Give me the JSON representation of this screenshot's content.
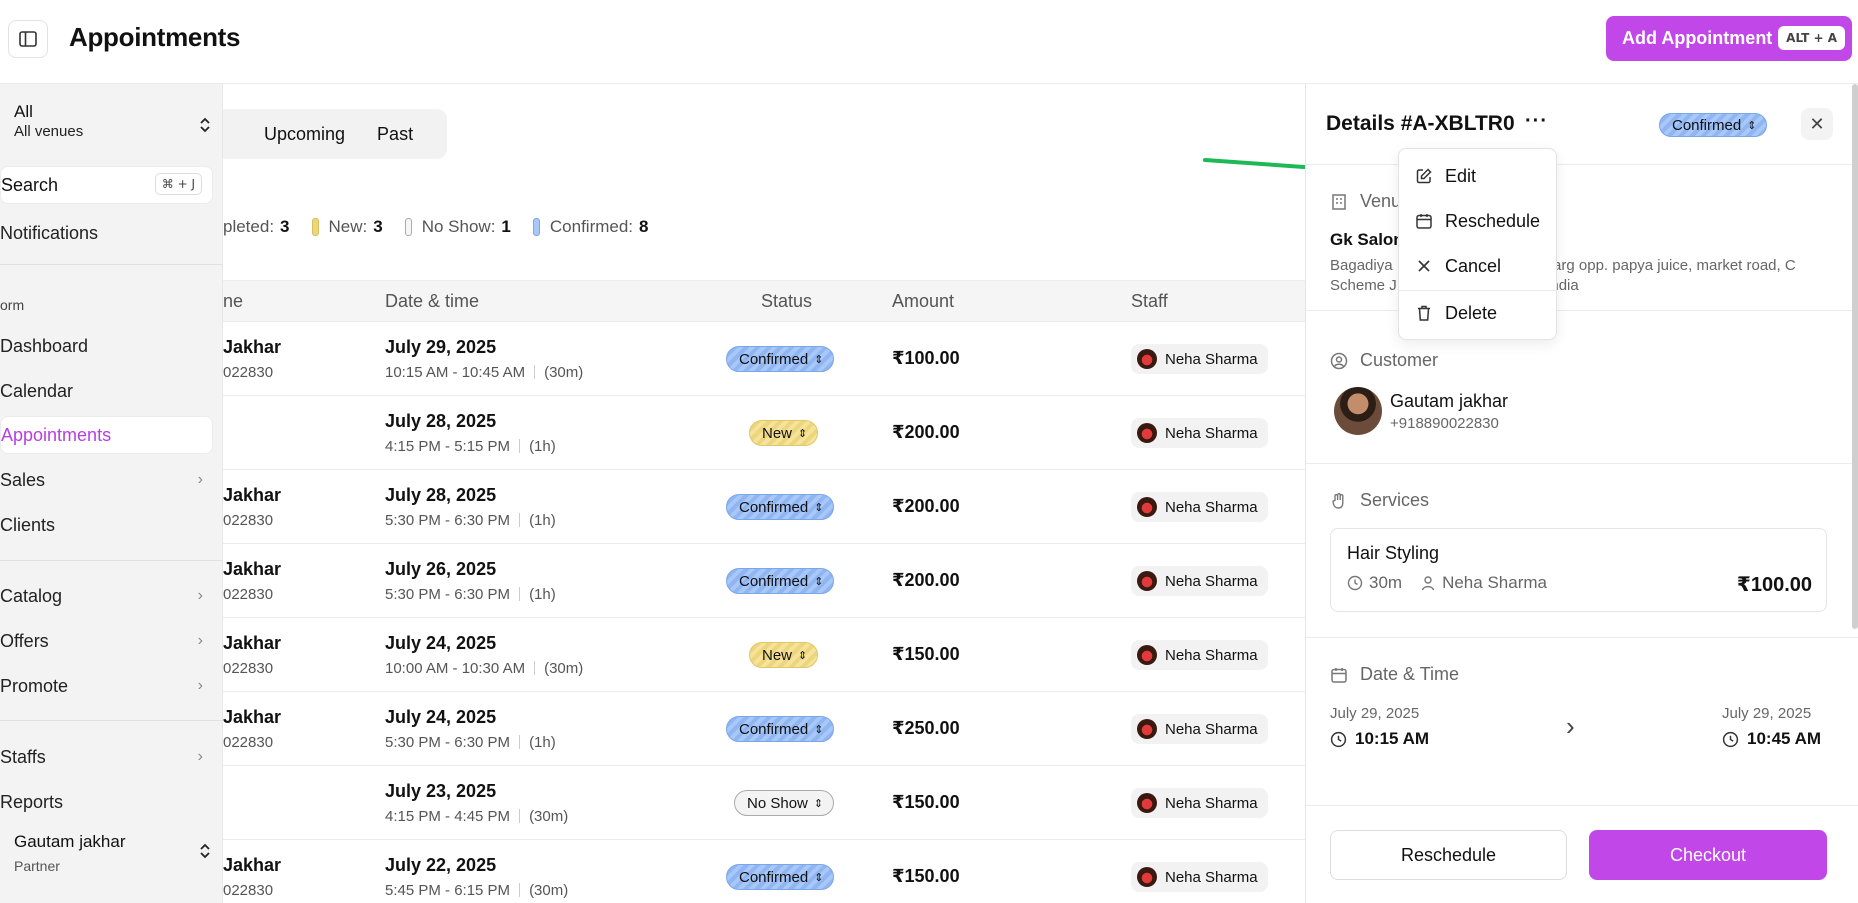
{
  "header": {
    "title": "Appointments",
    "add_button": "Add Appointment",
    "add_shortcut": "ALT + A"
  },
  "sidebar": {
    "venue_title": "All",
    "venue_subtitle": "All venues",
    "search_label": "Search",
    "search_shortcut": "⌘ + J",
    "notifications": "Notifications",
    "section_label": "orm",
    "items": [
      {
        "label": "Dashboard"
      },
      {
        "label": "Calendar"
      },
      {
        "label": "Appointments"
      },
      {
        "label": "Sales"
      },
      {
        "label": "Clients"
      },
      {
        "label": "Catalog"
      },
      {
        "label": "Offers"
      },
      {
        "label": "Promote"
      },
      {
        "label": "Staffs"
      },
      {
        "label": "Reports"
      }
    ],
    "user_name": "Gautam jakhar",
    "user_role": "Partner"
  },
  "tabs": [
    "Upcoming",
    "Past"
  ],
  "stats": [
    {
      "label": "pleted:",
      "count": "3",
      "color": "#cfcfcf"
    },
    {
      "label": "New:",
      "count": "3",
      "color": "#ecd57c"
    },
    {
      "label": "No Show:",
      "count": "1",
      "color": "#f3f3f3"
    },
    {
      "label": "Confirmed:",
      "count": "8",
      "color": "#8fb6f2"
    }
  ],
  "table": {
    "headers": {
      "name": "ne",
      "datetime": "Date & time",
      "status": "Status",
      "amount": "Amount",
      "staff": "Staff"
    },
    "rows": [
      {
        "name": "Jakhar",
        "phone": "022830",
        "date": "July 29, 2025",
        "time": "10:15 AM - 10:45 AM",
        "duration": "(30m)",
        "status": "Confirmed",
        "amount": "₹100.00",
        "staff": "Neha Sharma"
      },
      {
        "name": "",
        "phone": "",
        "date": "July 28, 2025",
        "time": "4:15 PM - 5:15 PM",
        "duration": "(1h)",
        "status": "New",
        "amount": "₹200.00",
        "staff": "Neha Sharma"
      },
      {
        "name": "Jakhar",
        "phone": "022830",
        "date": "July 28, 2025",
        "time": "5:30 PM - 6:30 PM",
        "duration": "(1h)",
        "status": "Confirmed",
        "amount": "₹200.00",
        "staff": "Neha Sharma"
      },
      {
        "name": "Jakhar",
        "phone": "022830",
        "date": "July 26, 2025",
        "time": "5:30 PM - 6:30 PM",
        "duration": "(1h)",
        "status": "Confirmed",
        "amount": "₹200.00",
        "staff": "Neha Sharma"
      },
      {
        "name": "Jakhar",
        "phone": "022830",
        "date": "July 24, 2025",
        "time": "10:00 AM - 10:30 AM",
        "duration": "(30m)",
        "status": "New",
        "amount": "₹150.00",
        "staff": "Neha Sharma"
      },
      {
        "name": "Jakhar",
        "phone": "022830",
        "date": "July 24, 2025",
        "time": "5:30 PM - 6:30 PM",
        "duration": "(1h)",
        "status": "Confirmed",
        "amount": "₹250.00",
        "staff": "Neha Sharma"
      },
      {
        "name": "",
        "phone": "",
        "date": "July 23, 2025",
        "time": "4:15 PM - 4:45 PM",
        "duration": "(30m)",
        "status": "No Show",
        "amount": "₹150.00",
        "staff": "Neha Sharma"
      },
      {
        "name": "Jakhar",
        "phone": "022830",
        "date": "July 22, 2025",
        "time": "5:45 PM - 6:15 PM",
        "duration": "(30m)",
        "status": "Confirmed",
        "amount": "₹150.00",
        "staff": "Neha Sharma"
      }
    ]
  },
  "details": {
    "title": "Details #A-XBLTR0",
    "more": "···",
    "status": "Confirmed",
    "venue_heading": "Venu",
    "venue_name": "Gk Salon",
    "venue_address_left": "Bagadiya",
    "venue_address_right": "marg opp. papya juice, market road, C",
    "venue_address_line2_left": "Scheme J",
    "venue_address_line2_right": "l India",
    "customer_heading": "Customer",
    "customer_name": "Gautam jakhar",
    "customer_phone": "+918890022830",
    "services_heading": "Services",
    "service_name": "Hair Styling",
    "service_duration": "30m",
    "service_staff": "Neha Sharma",
    "service_price": "₹100.00",
    "datetime_heading": "Date & Time",
    "start_date": "July 29, 2025",
    "start_time": "10:15 AM",
    "end_date": "July 29, 2025",
    "end_time": "10:45 AM",
    "reschedule_button": "Reschedule",
    "checkout_button": "Checkout"
  },
  "menu": {
    "items": [
      {
        "label": "Edit",
        "icon": "edit-icon"
      },
      {
        "label": "Reschedule",
        "icon": "calendar-icon"
      },
      {
        "label": "Cancel",
        "icon": "x-icon"
      },
      {
        "label": "Delete",
        "icon": "trash-icon"
      }
    ]
  },
  "colors": {
    "accent": "#c147e9",
    "confirmed": "#8fb6f2",
    "new": "#ecd57c",
    "annotation_arrow": "#1db954"
  }
}
